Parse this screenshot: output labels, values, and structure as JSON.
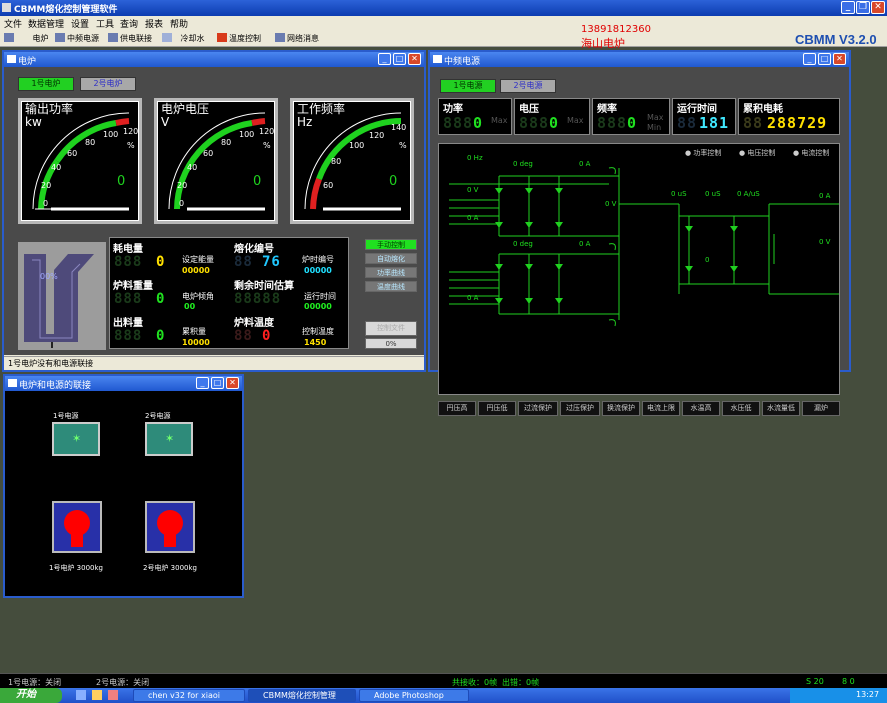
{
  "app": {
    "title": "CBMM熔化控制管理软件",
    "version": "CBMM V3.2.0",
    "ad_phone": "13891812360",
    "ad_name": "海山电炉"
  },
  "menu": [
    "文件",
    "数据管理",
    "设置",
    "工具",
    "查询",
    "报表",
    "帮助"
  ],
  "toolbar": [
    {
      "label": "电炉",
      "icon": "furnace-icon"
    },
    {
      "label": "中频电源",
      "icon": "power-icon"
    },
    {
      "label": "供电联接",
      "icon": "link-icon"
    },
    {
      "label": "冷却水",
      "icon": "water-icon"
    },
    {
      "label": "温度控制",
      "icon": "temperature-icon"
    },
    {
      "label": "网络消息",
      "icon": "network-icon"
    }
  ],
  "furnace_window": {
    "title": "电炉",
    "tabs": [
      "1号电炉",
      "2号电炉"
    ],
    "gauges": [
      {
        "title": "输出功率",
        "unit": "kw",
        "value": "0",
        "ticks": [
          "0",
          "20",
          "40",
          "60",
          "80",
          "100",
          "120"
        ],
        "pct": "%"
      },
      {
        "title": "电炉电压",
        "unit": "V",
        "value": "0",
        "ticks": [
          "0",
          "20",
          "40",
          "60",
          "80",
          "100",
          "120"
        ],
        "pct": "%"
      },
      {
        "title": "工作频率",
        "unit": "Hz",
        "value": "0",
        "ticks": [
          "60",
          "80",
          "100",
          "120",
          "140"
        ],
        "pct": "%"
      }
    ],
    "crucible_level": "00%",
    "metrics": {
      "power_consumption": {
        "label": "耗电量",
        "value": "0",
        "sub_label": "设定能量",
        "sub_value": "00000"
      },
      "melt_no": {
        "label": "熔化编号",
        "value": "76",
        "sub_label": "炉时编号",
        "sub_value": "00000"
      },
      "charge_weight": {
        "label": "炉料重量",
        "value": "0",
        "sub_label": "电炉倾角",
        "sub_value": "00"
      },
      "remaining_time": {
        "label": "剩余时间估算",
        "value": "00000",
        "sub_label": "运行时间",
        "sub_value": "00000"
      },
      "tap_weight": {
        "label": "出料量",
        "value": "0",
        "sub_label": "累积量",
        "sub_value": "10000"
      },
      "charge_temp": {
        "label": "炉料温度",
        "value": "0",
        "sub_label": "控制温度",
        "sub_value": "1450"
      }
    },
    "control_buttons": [
      "手动控制",
      "自动熔化",
      "功率曲线",
      "温度曲线"
    ],
    "control_file_button": "控制文件",
    "progress": "0%",
    "status": "1号电炉没有和电源联接"
  },
  "power_window": {
    "title": "中频电源",
    "tabs": [
      "1号电源",
      "2号电源"
    ],
    "readouts": [
      {
        "label": "功率",
        "value": "0",
        "tag": "Max"
      },
      {
        "label": "电压",
        "value": "0",
        "tag": "Max"
      },
      {
        "label": "频率",
        "value": "0",
        "tag": "Max",
        "tag2": "Min"
      },
      {
        "label": "运行时间",
        "value": "181"
      },
      {
        "label": "累积电耗",
        "value": "288729"
      }
    ],
    "legend": [
      "功率控制",
      "电压控制",
      "电流控制"
    ],
    "schematic_labels": {
      "hz": "0  Hz",
      "deg1": "0  deg",
      "deg2": "0  deg",
      "a1": "0  A",
      "a2": "0  A",
      "a3": "0  A",
      "a4": "0  A",
      "v1": "0  V",
      "v2": "0  V",
      "v3": "0  V",
      "us1": "0 uS",
      "us2": "0 uS",
      "aus": "0 A/uS",
      "a_right": "0  A",
      "zero": "0"
    },
    "bottom_buttons": [
      "円压高",
      "円压低",
      "过流保护",
      "过压保护",
      "换流保护",
      "电流上限",
      "水温高",
      "水压低",
      "水流量低",
      "漏炉"
    ]
  },
  "link_window": {
    "title": "电炉和电源的联接",
    "power1": "1号电源",
    "power2": "2号电源",
    "furnace1": "1号电炉 3000kg",
    "furnace2": "2号电炉 3000kg"
  },
  "statusbar": {
    "left1": "1号电源：关闭",
    "left2": "2号电源：关闭",
    "comm": "共接收：0帧",
    "comm2": "出错：0帧",
    "right": "S 20",
    "right2": "8  0"
  },
  "taskbar": {
    "start": "开始",
    "tasks": [
      "chen v32 for xiaoi",
      "CBMM熔化控制管理",
      "Adobe Photoshop"
    ],
    "clock": "13:27"
  },
  "colors": {
    "accent_green": "#20e020",
    "gauge_red": "#e02020",
    "title_blue": "#2a5ccc"
  }
}
